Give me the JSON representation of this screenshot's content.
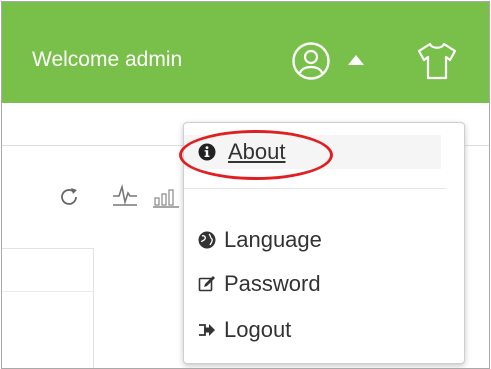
{
  "header": {
    "welcome_text": "Welcome admin",
    "bg_color": "#78c04a",
    "icons": [
      "user-circle-icon",
      "caret-up-icon",
      "tshirt-icon"
    ]
  },
  "toolbar": {
    "icons": [
      "refresh-icon",
      "line-chart-icon",
      "bar-chart-icon"
    ]
  },
  "user_menu": {
    "items": [
      {
        "label": "About",
        "icon": "info-circle-icon"
      },
      {
        "label": "Language",
        "icon": "globe-icon"
      },
      {
        "label": "Password",
        "icon": "edit-icon"
      },
      {
        "label": "Logout",
        "icon": "sign-out-icon"
      }
    ]
  },
  "annotation": {
    "highlight_color": "#e02020",
    "highlighted_item": "About"
  }
}
